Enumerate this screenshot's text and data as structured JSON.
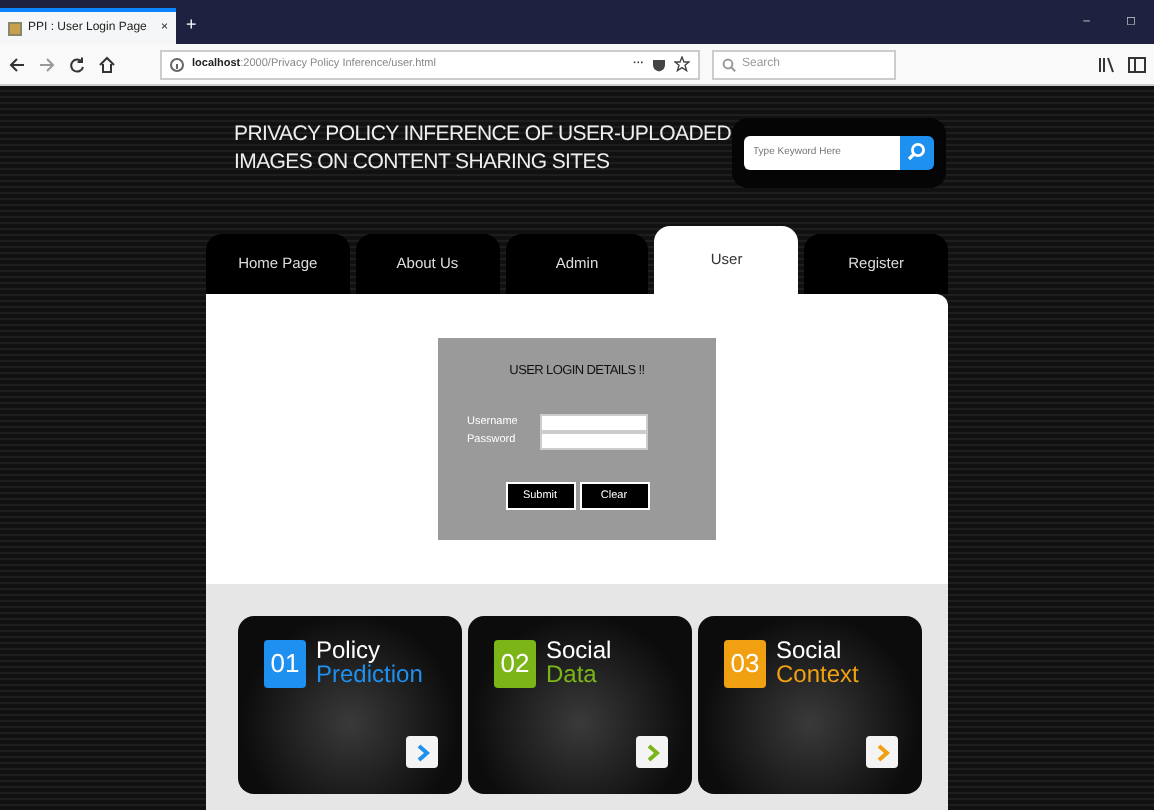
{
  "browser": {
    "tab_title": "PPI : User Login Page",
    "tab_close": "×",
    "new_tab": "+",
    "window_controls": [
      "–",
      "◻"
    ],
    "url_host": "localhost",
    "url_path": ":2000/Privacy Policy Inference/user.html",
    "more": "···",
    "search_placeholder": "Search"
  },
  "header": {
    "title_lines": [
      "PRIVACY POLICY INFERENCE OF USER-UPLOADED",
      "IMAGES ON CONTENT SHARING SITES"
    ],
    "search_placeholder": "Type Keyword Here"
  },
  "tabs": [
    {
      "label": "Home Page",
      "selected": false
    },
    {
      "label": "About Us",
      "selected": false
    },
    {
      "label": "Admin",
      "selected": false
    },
    {
      "label": "User",
      "selected": true
    },
    {
      "label": "Register",
      "selected": false
    }
  ],
  "login": {
    "title": "USER LOGIN DETAILS !!",
    "fields": [
      {
        "label": "Username"
      },
      {
        "label": "Password"
      }
    ],
    "buttons": [
      "Submit",
      "Clear"
    ]
  },
  "cards": [
    {
      "number": "01",
      "line1": "Policy",
      "line2": "Prediction",
      "color": "#1e90f0"
    },
    {
      "number": "02",
      "line1": "Social",
      "line2": "Data",
      "color": "#7cb518"
    },
    {
      "number": "03",
      "line1": "Social",
      "line2": "Context",
      "color": "#f0a010"
    }
  ]
}
